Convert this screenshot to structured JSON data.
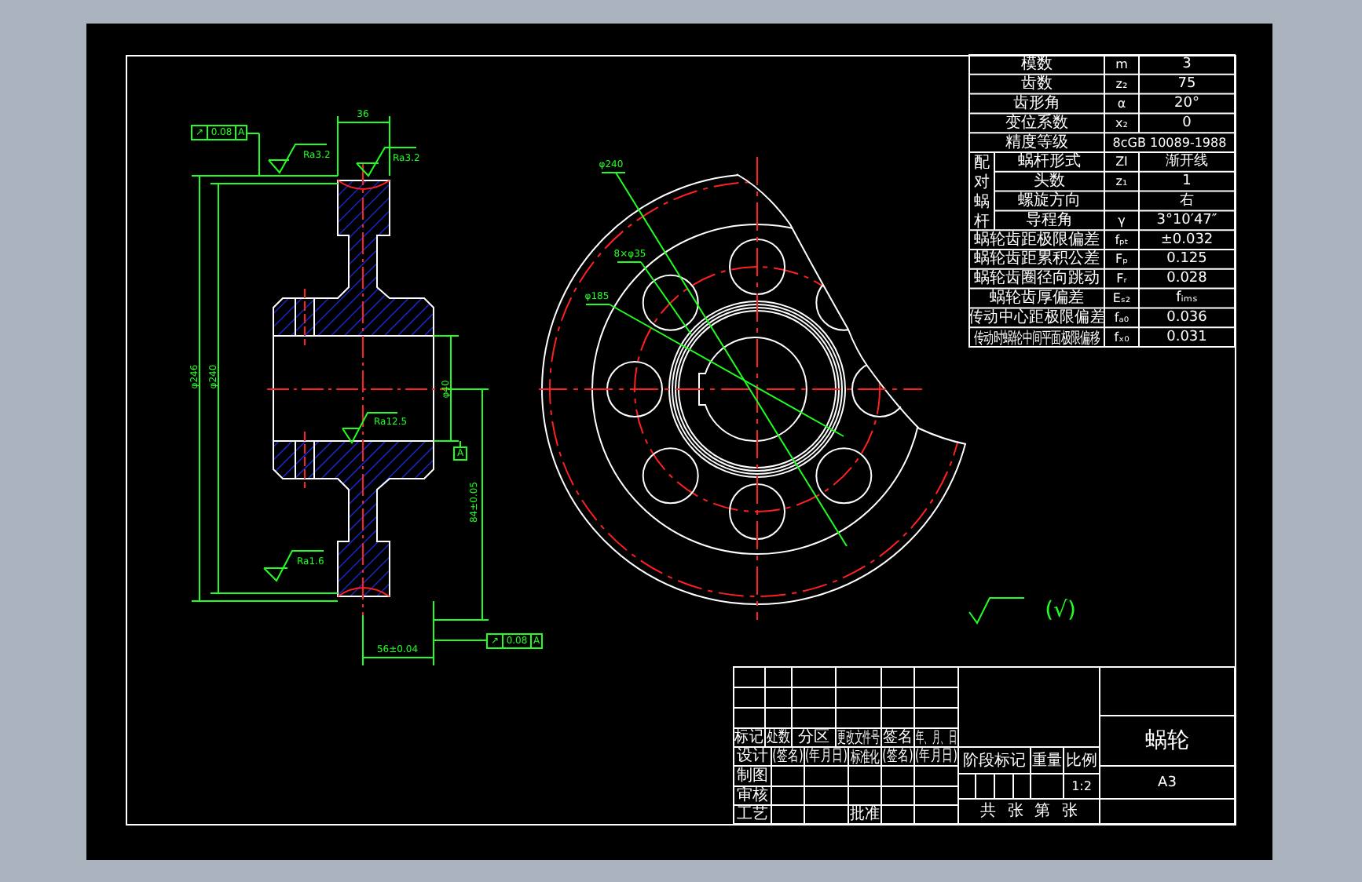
{
  "parameter_table": {
    "group_label": "配对蜗杆",
    "rows": [
      {
        "kind": "plain",
        "name": "模数",
        "symbol": "m",
        "value": "3"
      },
      {
        "kind": "plain",
        "name": "齿数",
        "symbol": "z₂",
        "value": "75"
      },
      {
        "kind": "plain",
        "name": "齿形角",
        "symbol": "α",
        "value": "20°"
      },
      {
        "kind": "plain",
        "name": "变位系数",
        "symbol": "x₂",
        "value": "0"
      },
      {
        "kind": "merged",
        "name": "精度等级",
        "value": "8cGB 10089-1988"
      },
      {
        "kind": "grouped",
        "name": "蜗杆形式",
        "symbol": "ZI",
        "value": "渐开线"
      },
      {
        "kind": "grouped",
        "name": "头数",
        "symbol": "z₁",
        "value": "1"
      },
      {
        "kind": "grouped",
        "name": "螺旋方向",
        "value": "右"
      },
      {
        "kind": "grouped",
        "name": "导程角",
        "symbol": "γ",
        "value": "3°10′47″"
      },
      {
        "kind": "plain",
        "name": "蜗轮齿距极限偏差",
        "symbol": "fₚₜ",
        "value": "±0.032"
      },
      {
        "kind": "plain",
        "name": "蜗轮齿距累积公差",
        "symbol": "Fₚ",
        "value": "0.125"
      },
      {
        "kind": "plain",
        "name": "蜗轮齿圈径向跳动",
        "symbol": "Fᵣ",
        "value": "0.028"
      },
      {
        "kind": "plain",
        "name": "蜗轮齿厚偏差",
        "symbol": "Eₛ₂",
        "value": "fᵢₘₛ"
      },
      {
        "kind": "plain",
        "name": "传动中心距极限偏差",
        "symbol": "fₐ₀",
        "value": "0.036"
      },
      {
        "kind": "plain",
        "name": "传动时蜗轮中间平面极限偏移",
        "symbol": "fₓ₀",
        "value": "0.031"
      }
    ]
  },
  "title_block": {
    "revision_header": [
      "标记",
      "处数",
      "分区",
      "更改文件号",
      "签名",
      "年、月、日"
    ],
    "design_row": [
      "设计",
      "(签名)",
      "(年月日)",
      "标准化",
      "(签名)",
      "(年月日)"
    ],
    "drawing_label": "制图",
    "review_label": "审核",
    "process_label": "工艺",
    "approve_label": "批准",
    "stage_label": "阶段标记",
    "weight_label": "重量",
    "scale_label": "比例",
    "scale": "1:2",
    "sheets": "共 张 第 张",
    "part_name": "蜗轮",
    "format": "A3"
  },
  "annotations": [
    {
      "kind": "roughness",
      "text": "Ra3.2"
    },
    {
      "kind": "roughness",
      "text": "Ra3.2"
    },
    {
      "kind": "roughness",
      "text": "Ra12.5"
    },
    {
      "kind": "roughness",
      "text": "Ra1.6"
    },
    {
      "kind": "tolerance",
      "symbol": "↗",
      "value": "0.08",
      "datum": "A"
    },
    {
      "kind": "tolerance",
      "symbol": "↗",
      "value": "0.08",
      "datum": "A"
    },
    {
      "kind": "datum",
      "text": "A"
    },
    {
      "kind": "dimension",
      "text": "36"
    },
    {
      "kind": "dimension",
      "text": "φ246"
    },
    {
      "kind": "dimension",
      "text": "φ240"
    },
    {
      "kind": "dimension",
      "text": "φ40"
    },
    {
      "kind": "dimension",
      "text": "84±0.05"
    },
    {
      "kind": "dimension",
      "text": "56±0.04"
    },
    {
      "kind": "dimension",
      "text": "φ240"
    },
    {
      "kind": "dimension",
      "text": "8×φ35"
    },
    {
      "kind": "dimension",
      "text": "φ185"
    }
  ],
  "general_roughness": "(√)"
}
